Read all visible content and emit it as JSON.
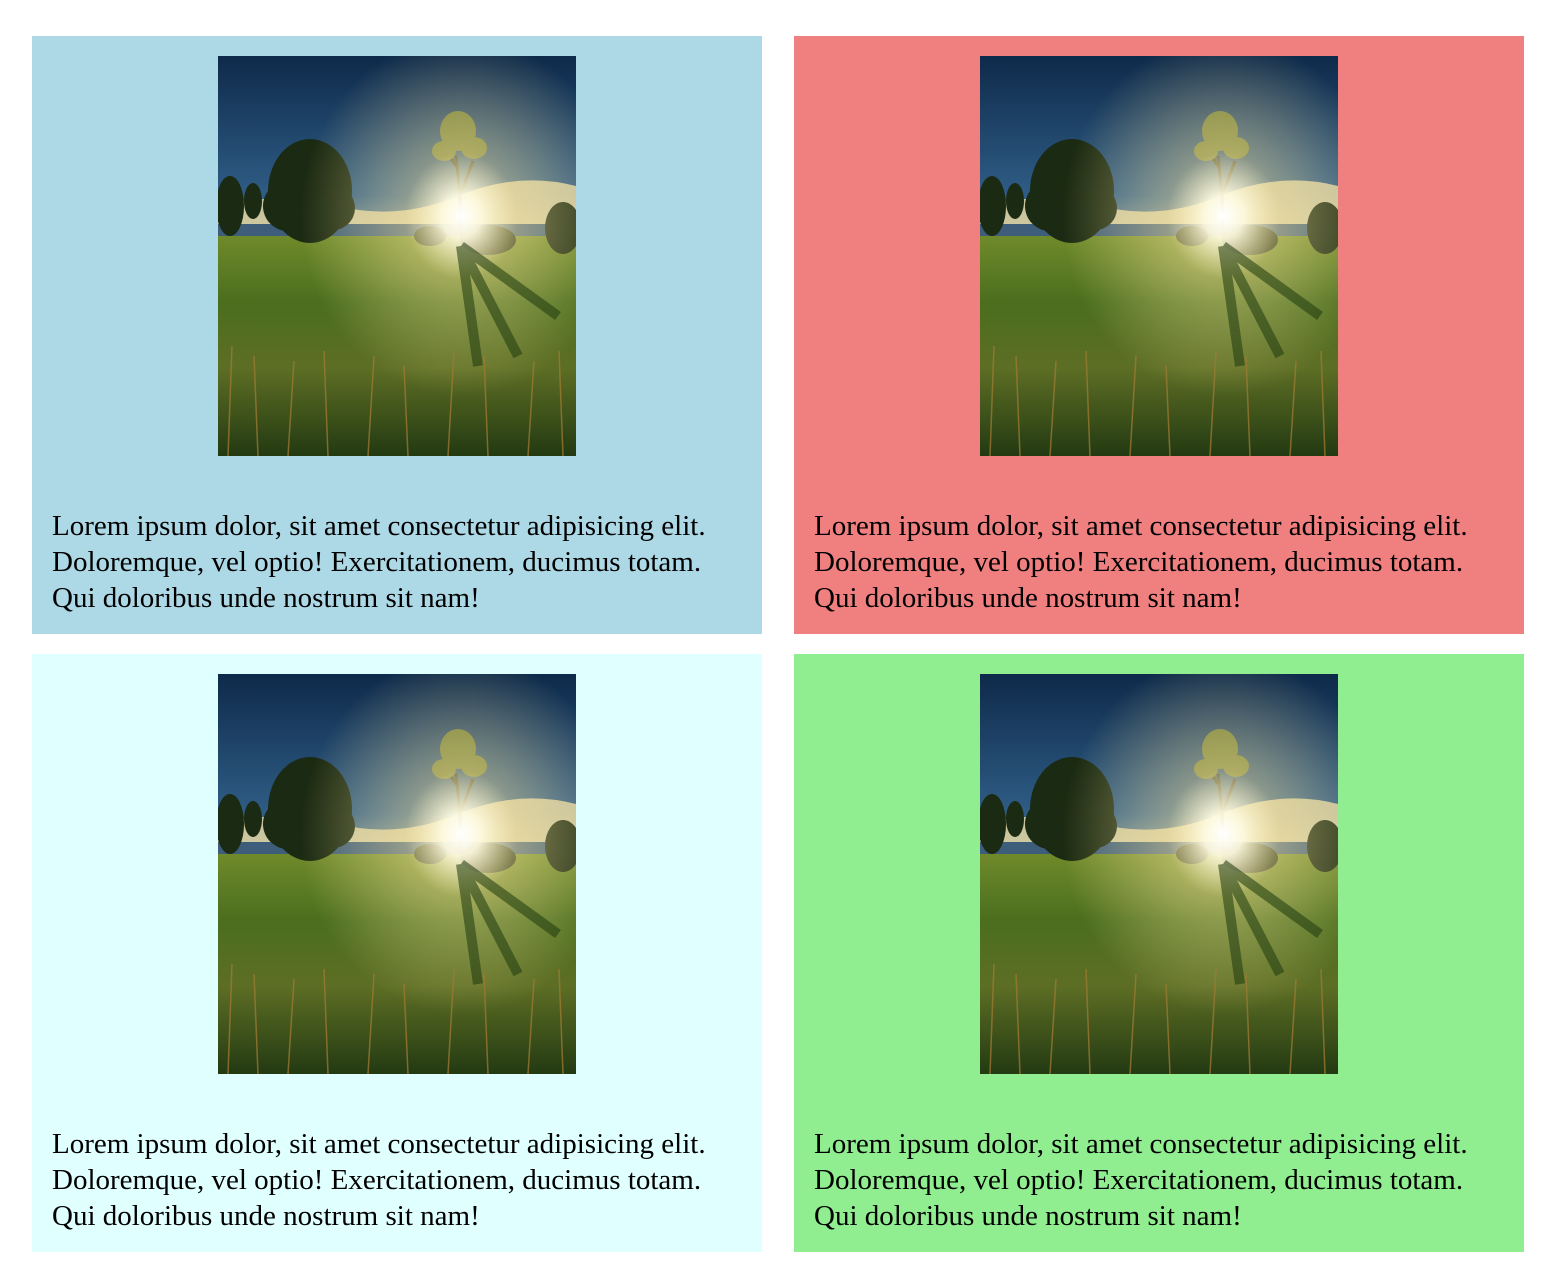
{
  "cards": [
    {
      "id": "card-1",
      "background": "#add8e6",
      "image_alt": "landscape-photo",
      "text": "Lorem ipsum dolor, sit amet consectetur adipisicing elit. Doloremque, vel optio! Exercitationem, ducimus totam. Qui doloribus unde nostrum sit nam!"
    },
    {
      "id": "card-2",
      "background": "#f08080",
      "image_alt": "landscape-photo",
      "text": "Lorem ipsum dolor, sit amet consectetur adipisicing elit. Doloremque, vel optio! Exercitationem, ducimus totam. Qui doloribus unde nostrum sit nam!"
    },
    {
      "id": "card-3",
      "background": "#e0ffff",
      "image_alt": "landscape-photo",
      "text": "Lorem ipsum dolor, sit amet consectetur adipisicing elit. Doloremque, vel optio! Exercitationem, ducimus totam. Qui doloribus unde nostrum sit nam!"
    },
    {
      "id": "card-4",
      "background": "#90ee90",
      "image_alt": "landscape-photo",
      "text": "Lorem ipsum dolor, sit amet consectetur adipisicing elit. Doloremque, vel optio! Exercitationem, ducimus totam. Qui doloribus unde nostrum sit nam!"
    }
  ]
}
